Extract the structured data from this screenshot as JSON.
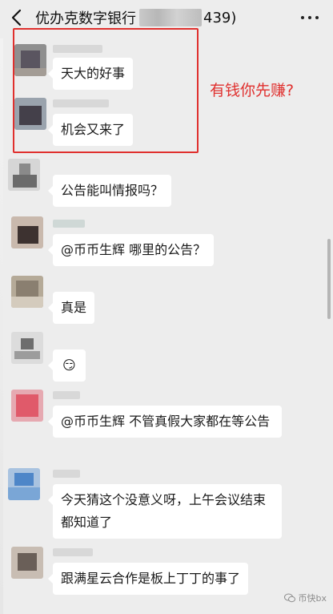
{
  "header": {
    "title_prefix": "优办克数字银行",
    "title_suffix": "439)"
  },
  "annotation": {
    "text": "有钱你先赚?"
  },
  "messages": [
    {
      "text": "天大的好事"
    },
    {
      "text": "机会又来了"
    },
    {
      "text": "公告能叫情报吗？"
    },
    {
      "text": "@币币生辉  哪里的公告？"
    },
    {
      "text": "真是"
    },
    {
      "text": "😏"
    },
    {
      "text": "@币币生辉  不管真假大家都在等公告"
    },
    {
      "text": "今天猜这个没意义呀，上午会议结束都知道了"
    },
    {
      "text": "跟满星云合作是板上丁丁的事了"
    }
  ],
  "watermark": {
    "text": "币快bx"
  },
  "colors": {
    "background": "#ededed",
    "bubble": "#ffffff",
    "highlight": "#e0302e"
  }
}
